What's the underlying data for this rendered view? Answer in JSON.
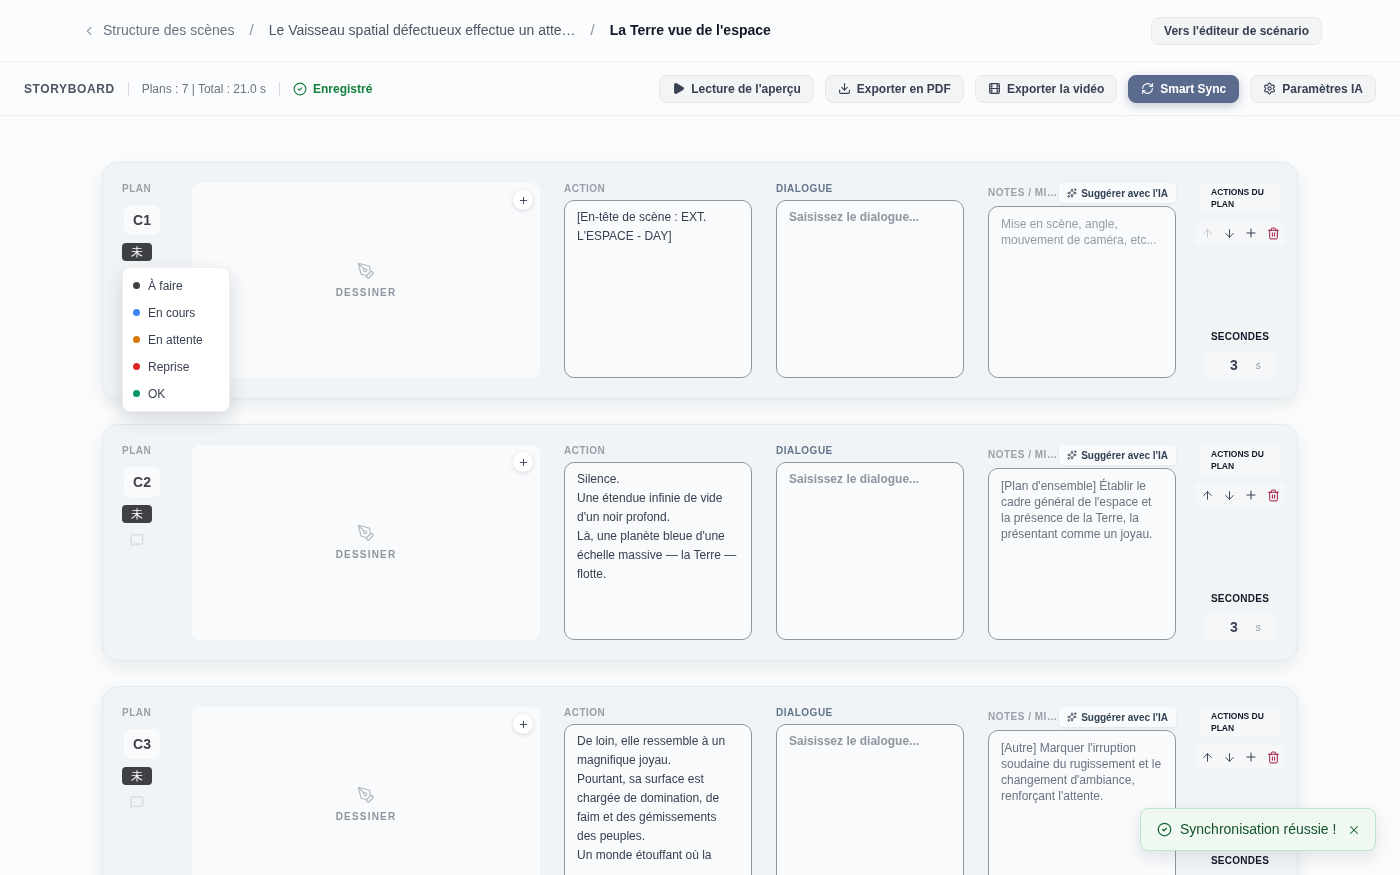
{
  "header": {
    "breadcrumb": [
      {
        "kind": "back",
        "label": "Structure des scènes"
      },
      {
        "kind": "separator",
        "label": "/"
      },
      {
        "kind": "link",
        "label": "Le Vaisseau spatial défectueux effectue un atte…"
      },
      {
        "kind": "separator",
        "label": "/"
      },
      {
        "kind": "current",
        "label": "La Terre vue de l'espace"
      }
    ],
    "editor_button": "Vers l'éditeur de scénario"
  },
  "toolbar": {
    "title": "STORYBOARD",
    "stats": "Plans : 7 | Total : 21.0 s",
    "save_status": "Enregistré",
    "buttons": [
      {
        "label": "Lecture de l'aperçu",
        "kind": "default"
      },
      {
        "label": "Exporter en PDF",
        "kind": "default"
      },
      {
        "label": "Exporter la vidéo",
        "kind": "default"
      },
      {
        "label": "Smart Sync",
        "kind": "primary"
      },
      {
        "label": "Paramètres IA",
        "kind": "default"
      }
    ]
  },
  "plans": [
    {
      "plan_label": "PLAN",
      "code": "C1",
      "status": "未",
      "status_menu": [
        {
          "label": "À faire",
          "color": "#3f3f46"
        },
        {
          "label": "En cours",
          "color": "#3b82f6"
        },
        {
          "label": "En attente",
          "color": "#d97706"
        },
        {
          "label": "Reprise",
          "color": "#dc2626"
        },
        {
          "label": "OK",
          "color": "#059669"
        }
      ],
      "sketch_label": "DESSINER",
      "action": {
        "label": "ACTION",
        "lines": [
          "[En-tête de scène : EXT. L'ESPACE - DAY]"
        ]
      },
      "dialogue": {
        "label": "DIALOGUE",
        "placeholder": "Saisissez le dialogue..."
      },
      "notes": {
        "label": "NOTES / MI…",
        "suggest_button": "Suggérer avec l'IA",
        "placeholder": "Mise en scène, angle, mouvement de caméra, etc..."
      },
      "actions_label": "ACTIONS DU PLAN",
      "move_up_disabled": true,
      "seconds_label": "SECONDES",
      "seconds": "3",
      "unit": "s"
    },
    {
      "plan_label": "PLAN",
      "code": "C2",
      "status": "未",
      "sketch_label": "DESSINER",
      "action": {
        "label": "ACTION",
        "lines": [
          "Silence.",
          "Une étendue infinie de vide d'un noir profond.",
          "Là, une planète bleue d'une échelle massive — la Terre — flotte."
        ]
      },
      "dialogue": {
        "label": "DIALOGUE",
        "placeholder": "Saisissez le dialogue..."
      },
      "notes": {
        "label": "NOTES / MI…",
        "suggest_button": "Suggérer avec l'IA",
        "text": "[Plan d'ensemble] Établir le cadre général de l'espace et la présence de la Terre, la présentant comme un joyau."
      },
      "actions_label": "ACTIONS DU PLAN",
      "move_up_disabled": false,
      "seconds_label": "SECONDES",
      "seconds": "3",
      "unit": "s"
    },
    {
      "plan_label": "PLAN",
      "code": "C3",
      "status": "未",
      "sketch_label": "DESSINER",
      "action": {
        "label": "ACTION",
        "lines": [
          "De loin, elle ressemble à un magnifique joyau.",
          "Pourtant, sa surface est chargée de domination, de faim et des gémissements des peuples.",
          "Un monde étouffant où la"
        ]
      },
      "dialogue": {
        "label": "DIALOGUE",
        "placeholder": "Saisissez le dialogue..."
      },
      "notes": {
        "label": "NOTES / MI…",
        "suggest_button": "Suggérer avec l'IA",
        "text": "[Autre] Marquer l'irruption soudaine du rugissement et le changement d'ambiance, renforçant l'attente."
      },
      "actions_label": "ACTIONS DU PLAN",
      "move_up_disabled": false,
      "seconds_label": "SECONDES"
    }
  ],
  "toast": {
    "message": "Synchronisation réussie !"
  }
}
